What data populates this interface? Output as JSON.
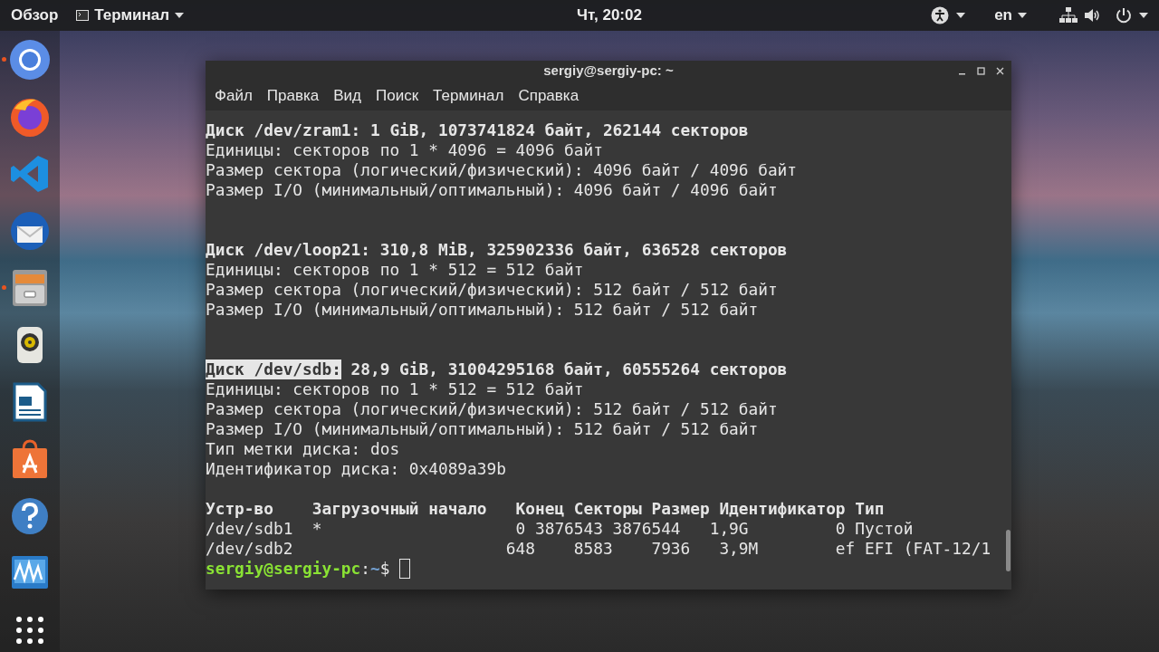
{
  "top_bar": {
    "activities": "Обзор",
    "app_menu": "Терминал",
    "clock": "Чт, 20:02",
    "language": "en"
  },
  "dock": [
    {
      "kind": "chromium",
      "running": true
    },
    {
      "kind": "firefox",
      "running": false
    },
    {
      "kind": "vscode",
      "running": false
    },
    {
      "kind": "thunderbird",
      "running": false
    },
    {
      "kind": "files",
      "running": true
    },
    {
      "kind": "speaker",
      "running": false
    },
    {
      "kind": "writer",
      "running": false
    },
    {
      "kind": "store",
      "running": false
    },
    {
      "kind": "help",
      "running": false
    },
    {
      "kind": "monitor",
      "running": false
    },
    {
      "kind": "grid",
      "running": false
    }
  ],
  "window": {
    "title": "sergiy@sergiy-pc: ~",
    "menu": [
      "Файл",
      "Правка",
      "Вид",
      "Поиск",
      "Терминал",
      "Справка"
    ]
  },
  "terminal": {
    "lines": [
      {
        "kind": "heading",
        "text": "Диск /dev/zram1: 1 GiB, 1073741824 байт, 262144 секторов"
      },
      {
        "kind": "plain",
        "text": "Единицы: секторов по 1 * 4096 = 4096 байт"
      },
      {
        "kind": "plain",
        "text": "Размер сектора (логический/физический): 4096 байт / 4096 байт"
      },
      {
        "kind": "plain",
        "text": "Размер I/O (минимальный/оптимальный): 4096 байт / 4096 байт"
      },
      {
        "kind": "blank"
      },
      {
        "kind": "blank"
      },
      {
        "kind": "heading",
        "text": "Диск /dev/loop21: 310,8 MiB, 325902336 байт, 636528 секторов"
      },
      {
        "kind": "plain",
        "text": "Единицы: секторов по 1 * 512 = 512 байт"
      },
      {
        "kind": "plain",
        "text": "Размер сектора (логический/физический): 512 байт / 512 байт"
      },
      {
        "kind": "plain",
        "text": "Размер I/O (минимальный/оптимальный): 512 байт / 512 байт"
      },
      {
        "kind": "blank"
      },
      {
        "kind": "blank"
      },
      {
        "kind": "heading",
        "selection": "Диск /dev/sdb:",
        "text": "28,9 GiB, 31004295168 байт, 60555264 секторов"
      },
      {
        "kind": "plain",
        "text": "Единицы: секторов по 1 * 512 = 512 байт"
      },
      {
        "kind": "plain",
        "text": "Размер сектора (логический/физический): 512 байт / 512 байт"
      },
      {
        "kind": "plain",
        "text": "Размер I/O (минимальный/оптимальный): 512 байт / 512 байт"
      },
      {
        "kind": "plain",
        "text": "Тип метки диска: dos"
      },
      {
        "kind": "plain",
        "text": "Идентификатор диска: 0x4089a39b"
      },
      {
        "kind": "blank"
      },
      {
        "kind": "heading",
        "text": "Устр-во    Загрузочный начало   Конец Секторы Размер Идентификатор Тип"
      },
      {
        "kind": "plain",
        "text": "/dev/sdb1  *                    0 3876543 3876544   1,9G         0 Пустой"
      },
      {
        "kind": "plain",
        "text": "/dev/sdb2                      648    8583    7936   3,9M        ef EFI (FAT-12/1"
      }
    ],
    "prompt": {
      "user_host": "sergiy@sergiy-pc",
      "separator": ":",
      "path": "~",
      "symbol": "$"
    }
  }
}
